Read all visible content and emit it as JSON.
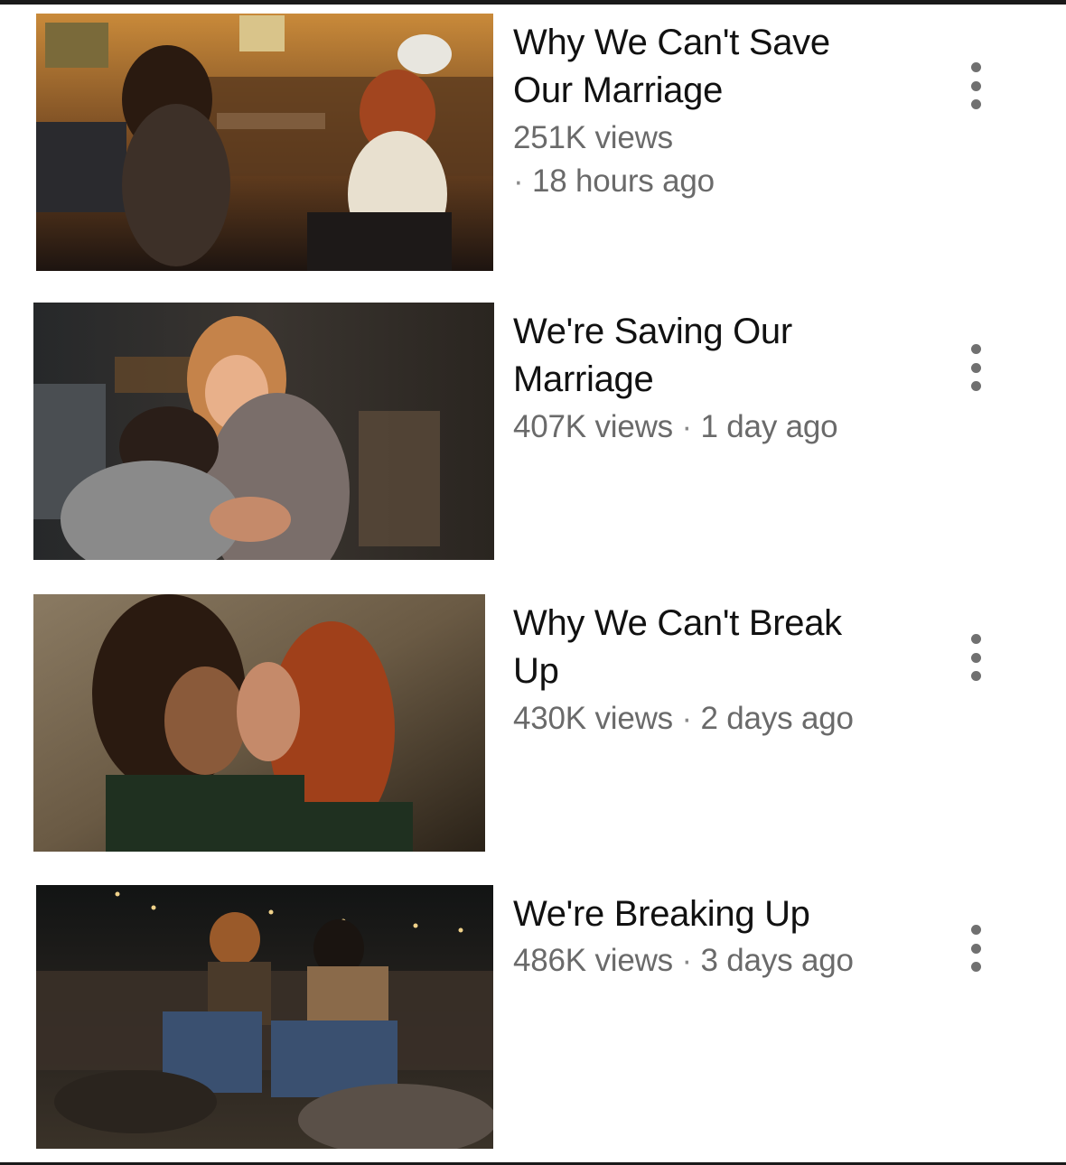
{
  "videos": [
    {
      "title": "Why We Can't Save Our Marriage",
      "views": "251K views",
      "age": "18 hours ago",
      "menu_icon": "more-vert-icon"
    },
    {
      "title": "We're Saving Our Marriage",
      "views": "407K views",
      "age": "1 day ago",
      "menu_icon": "more-vert-icon"
    },
    {
      "title": "Why We Can't Break Up",
      "views": "430K views",
      "age": "2 days ago",
      "menu_icon": "more-vert-icon"
    },
    {
      "title": "We're Breaking Up",
      "views": "486K views",
      "age": "3 days ago",
      "menu_icon": "more-vert-icon"
    }
  ],
  "colors": {
    "title_text": "#111111",
    "meta_text": "#6a6a6a",
    "kebab": "#707070",
    "border": "#1a1a1a"
  }
}
